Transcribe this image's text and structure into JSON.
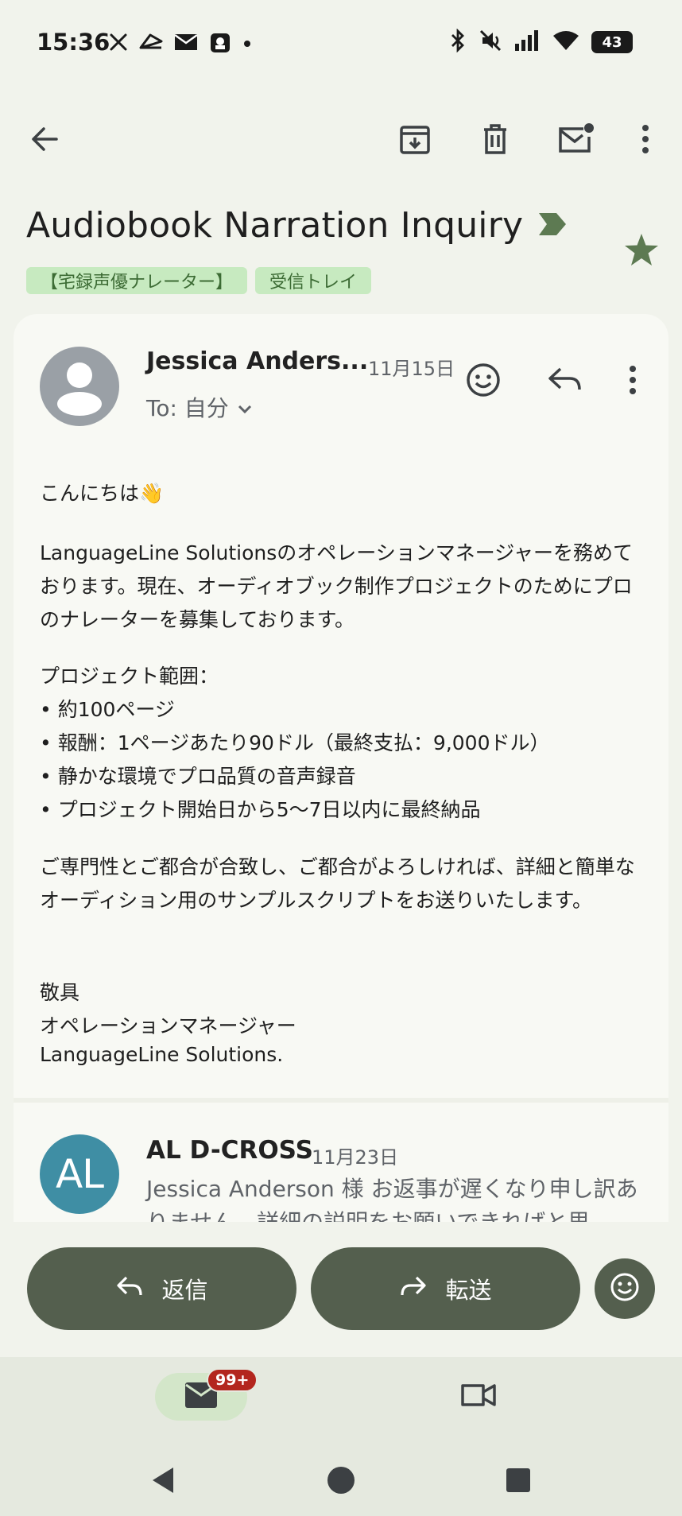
{
  "status_bar": {
    "time": "15:36",
    "battery": "43",
    "left_icons": [
      "x-icon",
      "send-icon",
      "mail-icon",
      "app-icon",
      "dot-icon"
    ],
    "right_icons": [
      "bluetooth-icon",
      "mute-icon",
      "signal-icon",
      "wifi-icon",
      "battery-icon"
    ]
  },
  "toolbar": {
    "icons": [
      "back-arrow-icon",
      "archive-icon",
      "delete-icon",
      "mark-unread-icon",
      "more-vert-icon"
    ]
  },
  "email": {
    "subject": "Audiobook Narration Inquiry",
    "starred": true,
    "labels": [
      "【宅録声優ナレーター】",
      "受信トレイ"
    ]
  },
  "message1": {
    "sender": "Jessica Anders...",
    "date": "11月15日",
    "to": "To: 自分",
    "greeting": "こんにちは👋",
    "para1": "LanguageLine Solutionsのオペレーションマネージャーを務めております。現在、オーディオブック制作プロジェクトのためにプロのナレーターを募集しております。",
    "scope_title": "プロジェクト範囲：",
    "scope_items": [
      "• 約100ページ",
      "• 報酬：1ページあたり90ドル（最終支払：9,000ドル）",
      "• 静かな環境でプロ品質の音声録音",
      "• プロジェクト開始日から5〜7日以内に最終納品"
    ],
    "para2": "ご専門性とご都合が合致し、ご都合がよろしければ、詳細と簡単なオーディション用のサンプルスクリプトをお送りいたします。",
    "closing": "敬具",
    "sig_title": "オペレーションマネージャー",
    "sig_company": "LanguageLine Solutions."
  },
  "message2": {
    "avatar_initials": "AL",
    "sender": "AL D-CROSS",
    "date": "11月23日",
    "snippet": "Jessica Anderson 様 お返事が遅くなり申し訳ありません。詳細の説明をお願いできればと思"
  },
  "actions": {
    "reply": "返信",
    "forward": "転送"
  },
  "bottom_nav": {
    "mail_badge": "99+"
  },
  "colors": {
    "accent": "#545f4e",
    "label_bg": "#c7eac0",
    "star": "#5d7a52",
    "badge": "#b3261e"
  }
}
